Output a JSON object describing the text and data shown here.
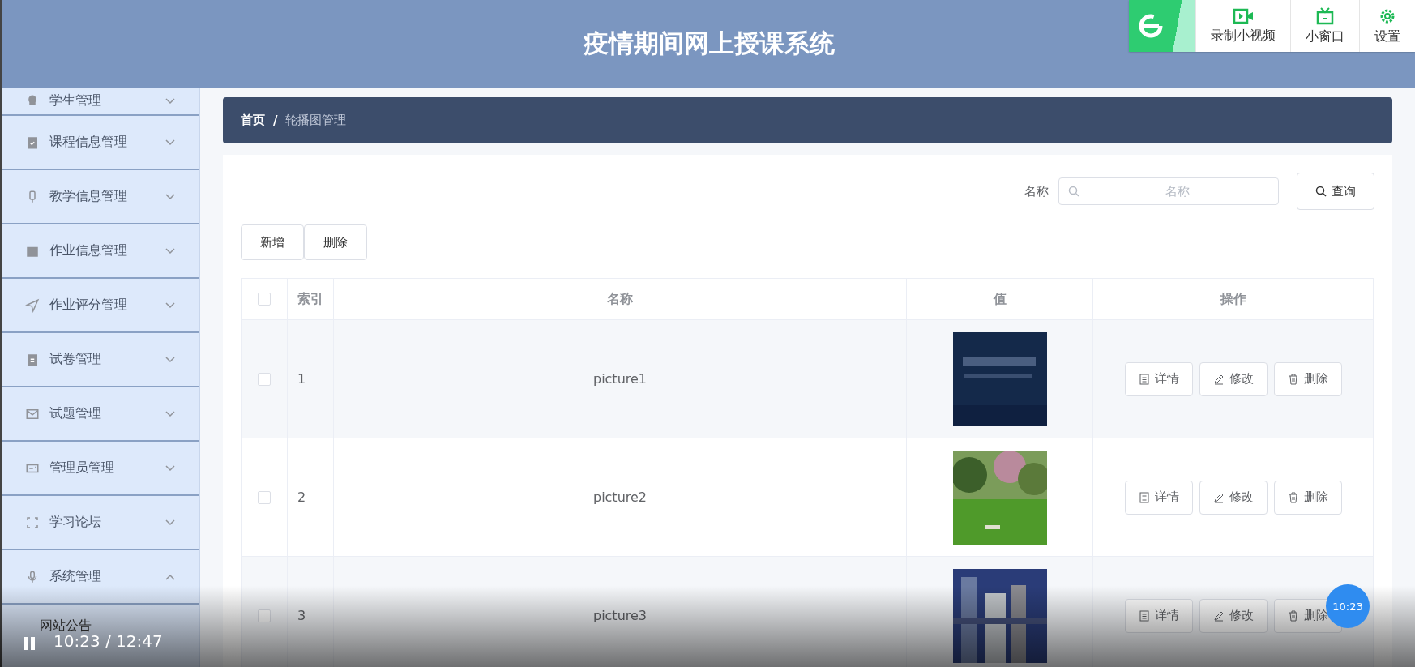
{
  "header": {
    "title": "疫情期间网上授课系统"
  },
  "browser_toolbar": {
    "items": [
      {
        "kind": "record",
        "label": "录制小视频"
      },
      {
        "kind": "window",
        "label": "小窗口"
      },
      {
        "kind": "settings",
        "label": "设置"
      }
    ]
  },
  "sidebar": {
    "items": [
      {
        "label": "学生管理",
        "expanded": false
      },
      {
        "label": "课程信息管理",
        "expanded": false
      },
      {
        "label": "教学信息管理",
        "expanded": false
      },
      {
        "label": "作业信息管理",
        "expanded": false
      },
      {
        "label": "作业评分管理",
        "expanded": false
      },
      {
        "label": "试卷管理",
        "expanded": false
      },
      {
        "label": "试题管理",
        "expanded": false
      },
      {
        "label": "管理员管理",
        "expanded": false
      },
      {
        "label": "学习论坛",
        "expanded": false
      },
      {
        "label": "系统管理",
        "expanded": true,
        "children": [
          {
            "label": "网站公告"
          }
        ]
      }
    ]
  },
  "breadcrumb": [
    "首页",
    "/",
    "轮播图管理"
  ],
  "search": {
    "label": "名称",
    "placeholder": "名称",
    "button": "查询"
  },
  "actions": [
    "新增",
    "删除"
  ],
  "table": {
    "select_all": {
      "checked": false
    },
    "columns": [
      "索引",
      "名称",
      "值",
      "操作"
    ],
    "rows": [
      {
        "checked": false,
        "index": "1",
        "name": "picture1",
        "value": {
          "kind": "picture"
        },
        "buttons": [
          "详情",
          "修改",
          "删除"
        ]
      },
      {
        "checked": false,
        "index": "2",
        "name": "picture2",
        "value": {
          "kind": "picture"
        },
        "buttons": [
          "详情",
          "修改",
          "删除"
        ]
      },
      {
        "checked": false,
        "index": "3",
        "name": "picture3",
        "value": {
          "kind": "picture"
        },
        "buttons": [
          "详情",
          "修改",
          "删除"
        ]
      }
    ]
  },
  "player": {
    "playing": true,
    "time": "10:23 / 12:47",
    "bubble": "10:23"
  }
}
